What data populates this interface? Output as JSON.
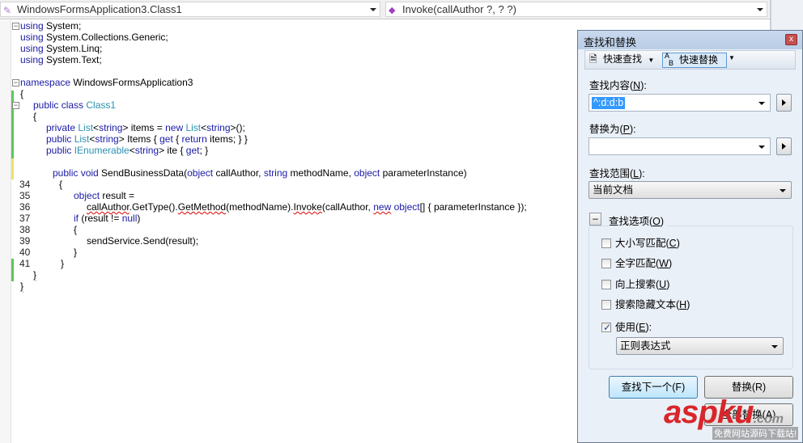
{
  "navbar": {
    "class_combo": "WindowsFormsApplication3.Class1",
    "member_combo": "Invoke(callAuthor ?, ? ?)"
  },
  "code": {
    "lines": [
      [
        [
          "kw",
          "using"
        ],
        [
          "p",
          " System;"
        ]
      ],
      [
        [
          "kw",
          "using"
        ],
        [
          "p",
          " System.Collections.Generic;"
        ]
      ],
      [
        [
          "kw",
          "using"
        ],
        [
          "p",
          " System.Linq;"
        ]
      ],
      [
        [
          "kw",
          "using"
        ],
        [
          "p",
          " System.Text;"
        ]
      ],
      [],
      [
        [
          "kw",
          "namespace"
        ],
        [
          "p",
          " WindowsFormsApplication3"
        ]
      ],
      [
        [
          "p",
          "{"
        ]
      ],
      [
        [
          "kw",
          "public class "
        ],
        [
          "ty",
          "Class1"
        ]
      ],
      [
        [
          "p",
          "{"
        ]
      ],
      [
        [
          "kw",
          "private "
        ],
        [
          "ty",
          "List"
        ],
        [
          "p",
          "<"
        ],
        [
          "kw",
          "string"
        ],
        [
          "p",
          "> items = "
        ],
        [
          "kw",
          "new "
        ],
        [
          "ty",
          "List"
        ],
        [
          "p",
          "<"
        ],
        [
          "kw",
          "string"
        ],
        [
          "p",
          ">();"
        ]
      ],
      [
        [
          "kw",
          "public "
        ],
        [
          "ty",
          "List"
        ],
        [
          "p",
          "<"
        ],
        [
          "kw",
          "string"
        ],
        [
          "p",
          "> Items { "
        ],
        [
          "kw",
          "get"
        ],
        [
          "p",
          " { "
        ],
        [
          "kw",
          "return"
        ],
        [
          "p",
          " items; } }"
        ]
      ],
      [
        [
          "kw",
          "public "
        ],
        [
          "ty",
          "IEnumerable"
        ],
        [
          "p",
          "<"
        ],
        [
          "kw",
          "string"
        ],
        [
          "p",
          "> ite { "
        ],
        [
          "kw",
          "get"
        ],
        [
          "p",
          "; }"
        ]
      ],
      [],
      [
        [
          "kw",
          "public void"
        ],
        [
          "p",
          " SendBusinessData("
        ],
        [
          "kw",
          "object"
        ],
        [
          "p",
          " callAuthor, "
        ],
        [
          "kw",
          "string"
        ],
        [
          "p",
          " methodName, "
        ],
        [
          "kw",
          "object"
        ],
        [
          "p",
          " parameterInstance)"
        ]
      ],
      [
        [
          "p",
          "{"
        ]
      ],
      [
        [
          "kw",
          "object"
        ],
        [
          "p",
          " result ="
        ]
      ],
      [
        [
          "err",
          "callAuthor"
        ],
        [
          "p",
          ".GetType()."
        ],
        [
          "err",
          "GetMethod"
        ],
        [
          "p",
          "(methodName)."
        ],
        [
          "err",
          "Invoke"
        ],
        [
          "p",
          "(callAuthor, "
        ],
        [
          "kwerr",
          "new"
        ],
        [
          "kw",
          " object"
        ],
        [
          "p",
          "[] { parameterInstance });"
        ]
      ],
      [
        [
          "kw",
          "if"
        ],
        [
          "p",
          " (result != "
        ],
        [
          "kw",
          "null"
        ],
        [
          "p",
          ")"
        ]
      ],
      [
        [
          "p",
          "{"
        ]
      ],
      [
        [
          "p",
          "sendService.Send(result);"
        ]
      ],
      [
        [
          "p",
          "}"
        ]
      ],
      [
        [
          "p",
          "}"
        ]
      ],
      [
        [
          "err",
          "}"
        ]
      ],
      [
        [
          "err",
          "}"
        ]
      ]
    ],
    "line_numbers": [
      "34",
      "35",
      "36",
      "37",
      "38",
      "39",
      "40",
      "41"
    ]
  },
  "dialog": {
    "title": "查找和替换",
    "quick_find": "快速查找",
    "quick_replace": "快速替换",
    "find_label": "查找内容(",
    "find_key": "N",
    "find_value": "^:d:d:b",
    "replace_label": "替换为(",
    "replace_key": "P",
    "replace_value": "",
    "scope_label": "查找范围(",
    "scope_key": "L",
    "scope_value": "当前文档",
    "options_label": "查找选项(",
    "options_key": "O",
    "options": [
      {
        "label": "大小写匹配(",
        "key": "C",
        "checked": false
      },
      {
        "label": "全字匹配(",
        "key": "W",
        "checked": false
      },
      {
        "label": "向上搜索(",
        "key": "U",
        "checked": false
      },
      {
        "label": "搜索隐藏文本(",
        "key": "H",
        "checked": false
      },
      {
        "label": "使用(",
        "key": "E",
        "checked": true
      }
    ],
    "use_value": "正则表达式",
    "find_next": "查找下一个(F)",
    "replace": "替换(R)",
    "replace_all": "全部替换(A)"
  },
  "watermark": {
    "brand": "aspku",
    "suffix": ".com",
    "tagline": "免费网站源码下载站!",
    "color": "#d9262b"
  }
}
